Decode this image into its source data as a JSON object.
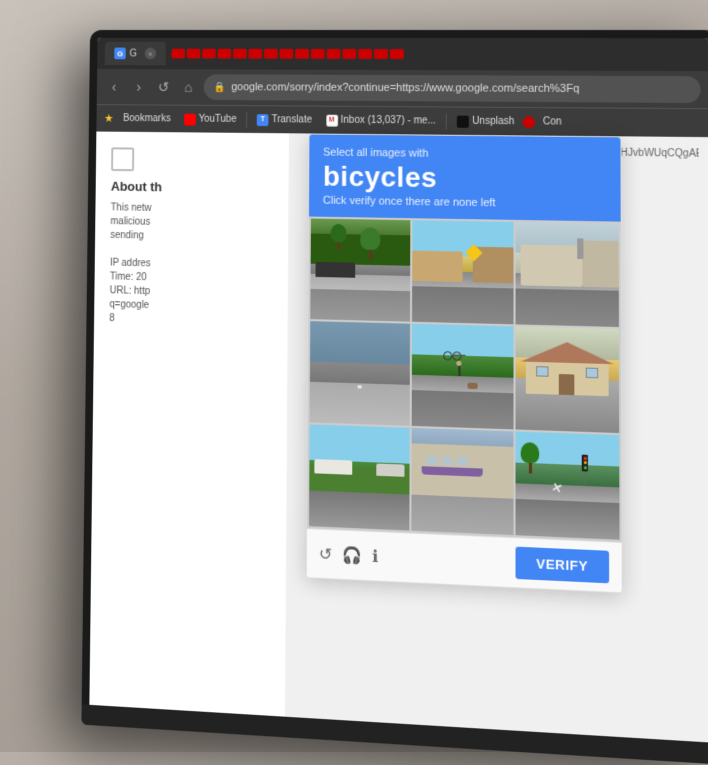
{
  "browser": {
    "tab_label": "G",
    "address_url": "google.com/sorry/index?continue=https://www.google.com/search%3Fq",
    "url_overflow": "rp=EgZjaHJvbWUqCQgAEEUYOxiA",
    "bookmarks": [
      {
        "label": "Bookmarks",
        "type": "star"
      },
      {
        "label": "YouTube",
        "type": "yt"
      },
      {
        "label": "Translate",
        "type": "translate"
      },
      {
        "label": "Inbox (13,037) - me...",
        "type": "gmail"
      },
      {
        "label": "Unsplash",
        "type": "unsplash"
      },
      {
        "label": "",
        "type": "red"
      },
      {
        "label": "Con",
        "type": "text"
      }
    ]
  },
  "captcha": {
    "select_text": "Select all images with",
    "main_word": "bicycles",
    "instruction": "Click verify once there are none left",
    "verify_label": "VERIFY",
    "grid_count": 9,
    "icons": {
      "refresh": "↺",
      "headphones": "🎧",
      "info": "ℹ"
    }
  },
  "page": {
    "about_title": "About th",
    "about_lines": [
      "This netw",
      "malicious",
      "sending",
      "",
      "IP addres",
      "Time: 20",
      "URL: http",
      "q=google",
      "8"
    ]
  }
}
